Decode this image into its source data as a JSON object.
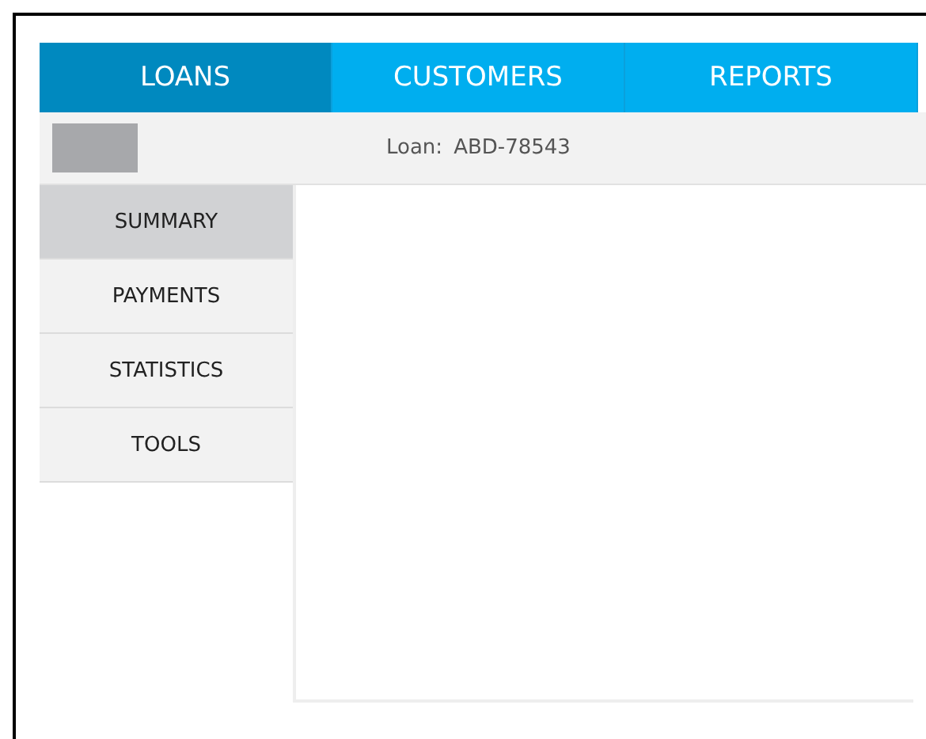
{
  "tabs": [
    {
      "label": "LOANS",
      "selected": true
    },
    {
      "label": "CUSTOMERS",
      "selected": false
    },
    {
      "label": "REPORTS",
      "selected": false
    }
  ],
  "header": {
    "label": "Loan:",
    "value": "ABD-78543"
  },
  "sidebar": {
    "items": [
      {
        "label": "SUMMARY",
        "selected": true
      },
      {
        "label": "PAYMENTS",
        "selected": false
      },
      {
        "label": "STATISTICS",
        "selected": false
      },
      {
        "label": "TOOLS",
        "selected": false
      }
    ]
  }
}
